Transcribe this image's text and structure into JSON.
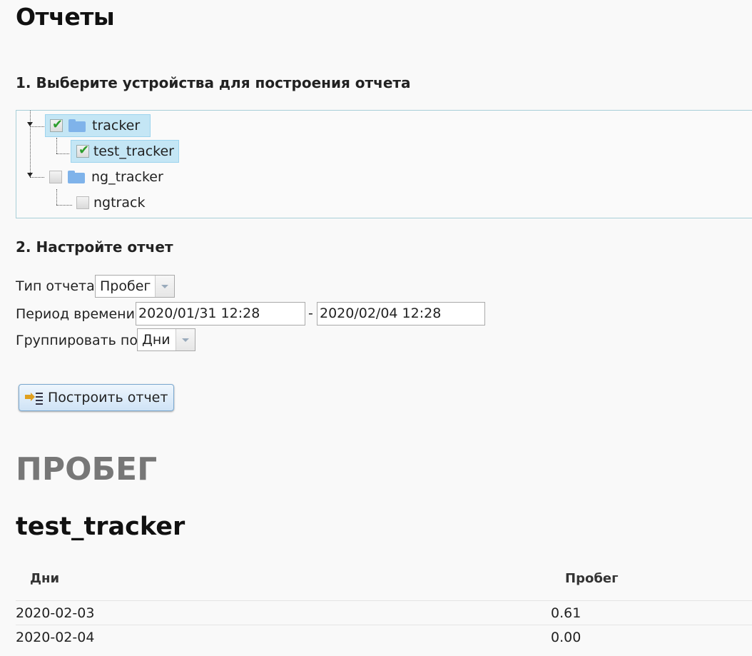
{
  "page_title": "Отчеты",
  "step1": {
    "heading": "1. Выберите устройства для построения отчета"
  },
  "tree": {
    "groups": [
      {
        "label": "tracker",
        "checked": true,
        "selected": true,
        "children": [
          {
            "label": "test_tracker",
            "checked": true,
            "selected": true
          }
        ]
      },
      {
        "label": "ng_tracker",
        "checked": false,
        "selected": false,
        "children": [
          {
            "label": "ngtrack",
            "checked": false,
            "selected": false
          }
        ]
      }
    ]
  },
  "step2": {
    "heading": "2. Настройте отчет",
    "report_type": {
      "label": "Тип отчета",
      "value": "Пробег"
    },
    "period": {
      "label": "Период времени",
      "from": "2020/01/31 12:28",
      "separator": "-",
      "to": "2020/02/04 12:28"
    },
    "group_by": {
      "label": "Группировать по",
      "value": "Дни"
    }
  },
  "build_button": {
    "label": "Построить отчет"
  },
  "report": {
    "title": "ПРОБЕГ",
    "device": "test_tracker",
    "columns": [
      "Дни",
      "Пробег"
    ],
    "rows": [
      {
        "day": "2020-02-03",
        "mileage": "0.61"
      },
      {
        "day": "2020-02-04",
        "mileage": "0.00"
      }
    ]
  }
}
